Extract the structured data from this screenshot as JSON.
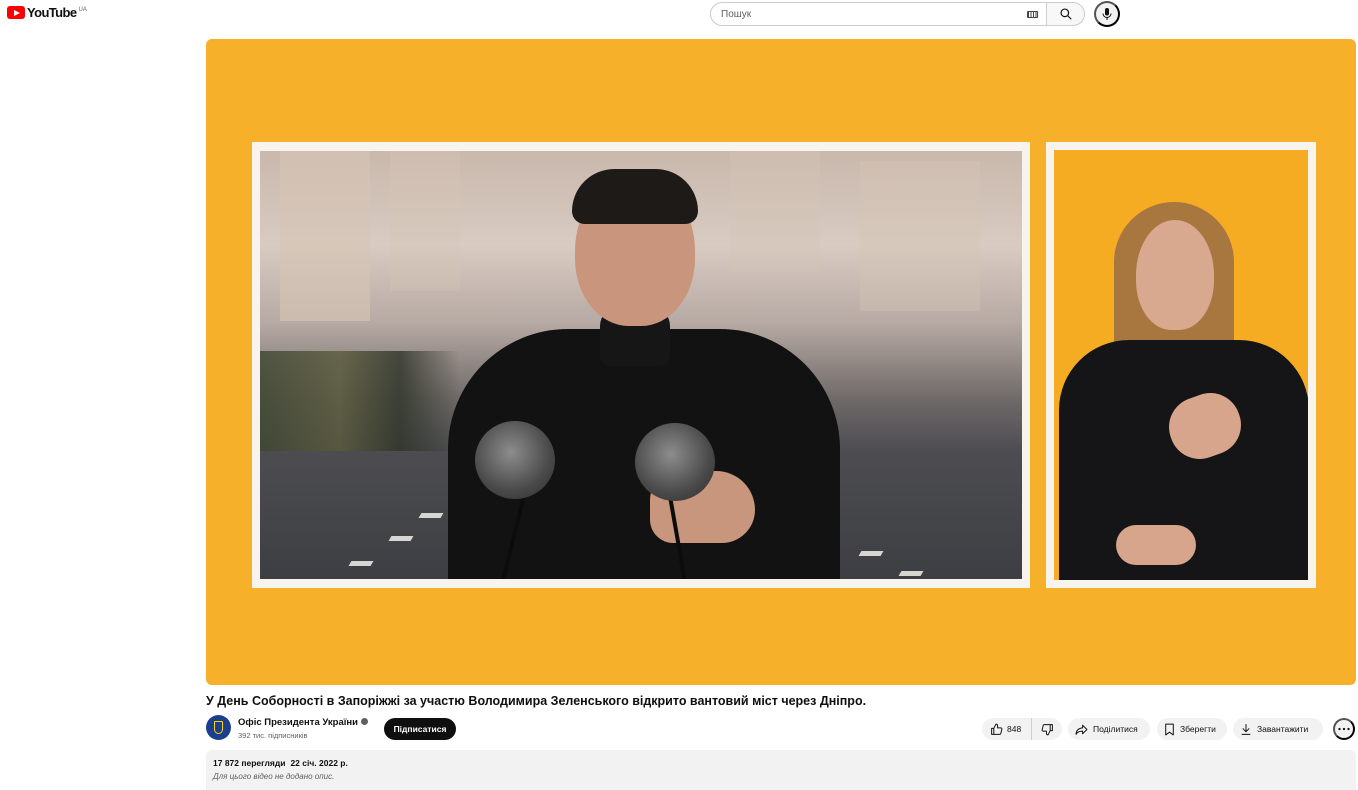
{
  "header": {
    "logo_text": "YouTube",
    "logo_region": "UA",
    "search_placeholder": "Пошук"
  },
  "video": {
    "title": "У День Соборності в Запоріжжі за участю Володимира Зеленського відкрито вантовий міст через Дніпро."
  },
  "channel": {
    "name": "Офіс Президента України",
    "subscribers": "392 тис. підписників",
    "subscribe_label": "Підписатися"
  },
  "actions": {
    "likes": "848",
    "share_label": "Поділитися",
    "save_label": "Зберегти",
    "download_label": "Завантажити"
  },
  "description": {
    "views": "17 872 перегляди",
    "date": "22 січ. 2022 р.",
    "text": "Для цього відео не додано опис."
  },
  "colors": {
    "player_background": "#f6b02a",
    "youtube_red": "#ff0000",
    "subscribe_button": "#0f0f0f"
  },
  "icons": {
    "keyboard": "keyboard-icon",
    "search": "search-icon",
    "mic": "microphone-icon",
    "like": "thumbs-up-icon",
    "dislike": "thumbs-down-icon",
    "share": "share-arrow-icon",
    "save": "bookmark-icon",
    "download": "download-icon",
    "more": "more-horizontal-icon"
  }
}
